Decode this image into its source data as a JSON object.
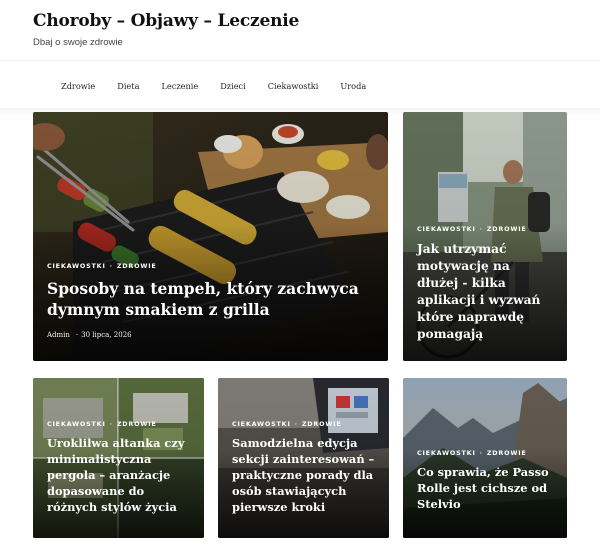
{
  "header": {
    "site_title": "Choroby – Objawy – Leczenie",
    "tagline": "Dbaj o swoje zdrowie"
  },
  "nav": {
    "items": [
      {
        "label": "Zdrowie"
      },
      {
        "label": "Dieta"
      },
      {
        "label": "Leczenie"
      },
      {
        "label": "Dzieci"
      },
      {
        "label": "Ciekawostki"
      },
      {
        "label": "Uroda"
      }
    ]
  },
  "posts": [
    {
      "categories": [
        "CIEKAWOSTKI",
        "ZDROWIE"
      ],
      "title": "Sposoby na tempeh, który zachwyca dymnym smakiem z grilla",
      "author": "Admin",
      "date": "30 lipca, 2026",
      "image": "grill-skewers-photo"
    },
    {
      "categories": [
        "CIEKAWOSTKI",
        "ZDROWIE"
      ],
      "title": "Jak utrzymać motywację na dłużej - kilka aplikacji i wyzwań które naprawdę pomagają",
      "image": "cyclist-city-photo"
    },
    {
      "categories": [
        "CIEKAWOSTKI",
        "ZDROWIE"
      ],
      "title": "Uroklilwa altanka czy minimalistyczna pergola – aranżacje dopasowane do różnych stylów życia",
      "image": "garden-collage-photo"
    },
    {
      "categories": [
        "CIEKAWOSTKI",
        "ZDROWIE"
      ],
      "title": "Samodzielna edycja sekcji zainteresowań – praktyczne porady dla osób stawiających pierwsze kroki",
      "image": "laptop-desk-photo"
    },
    {
      "categories": [
        "CIEKAWOSTKI",
        "ZDROWIE"
      ],
      "title": "Co sprawia, że Passo Rolle jest cichsze od Stelvio",
      "image": "mountain-pass-photo"
    }
  ]
}
